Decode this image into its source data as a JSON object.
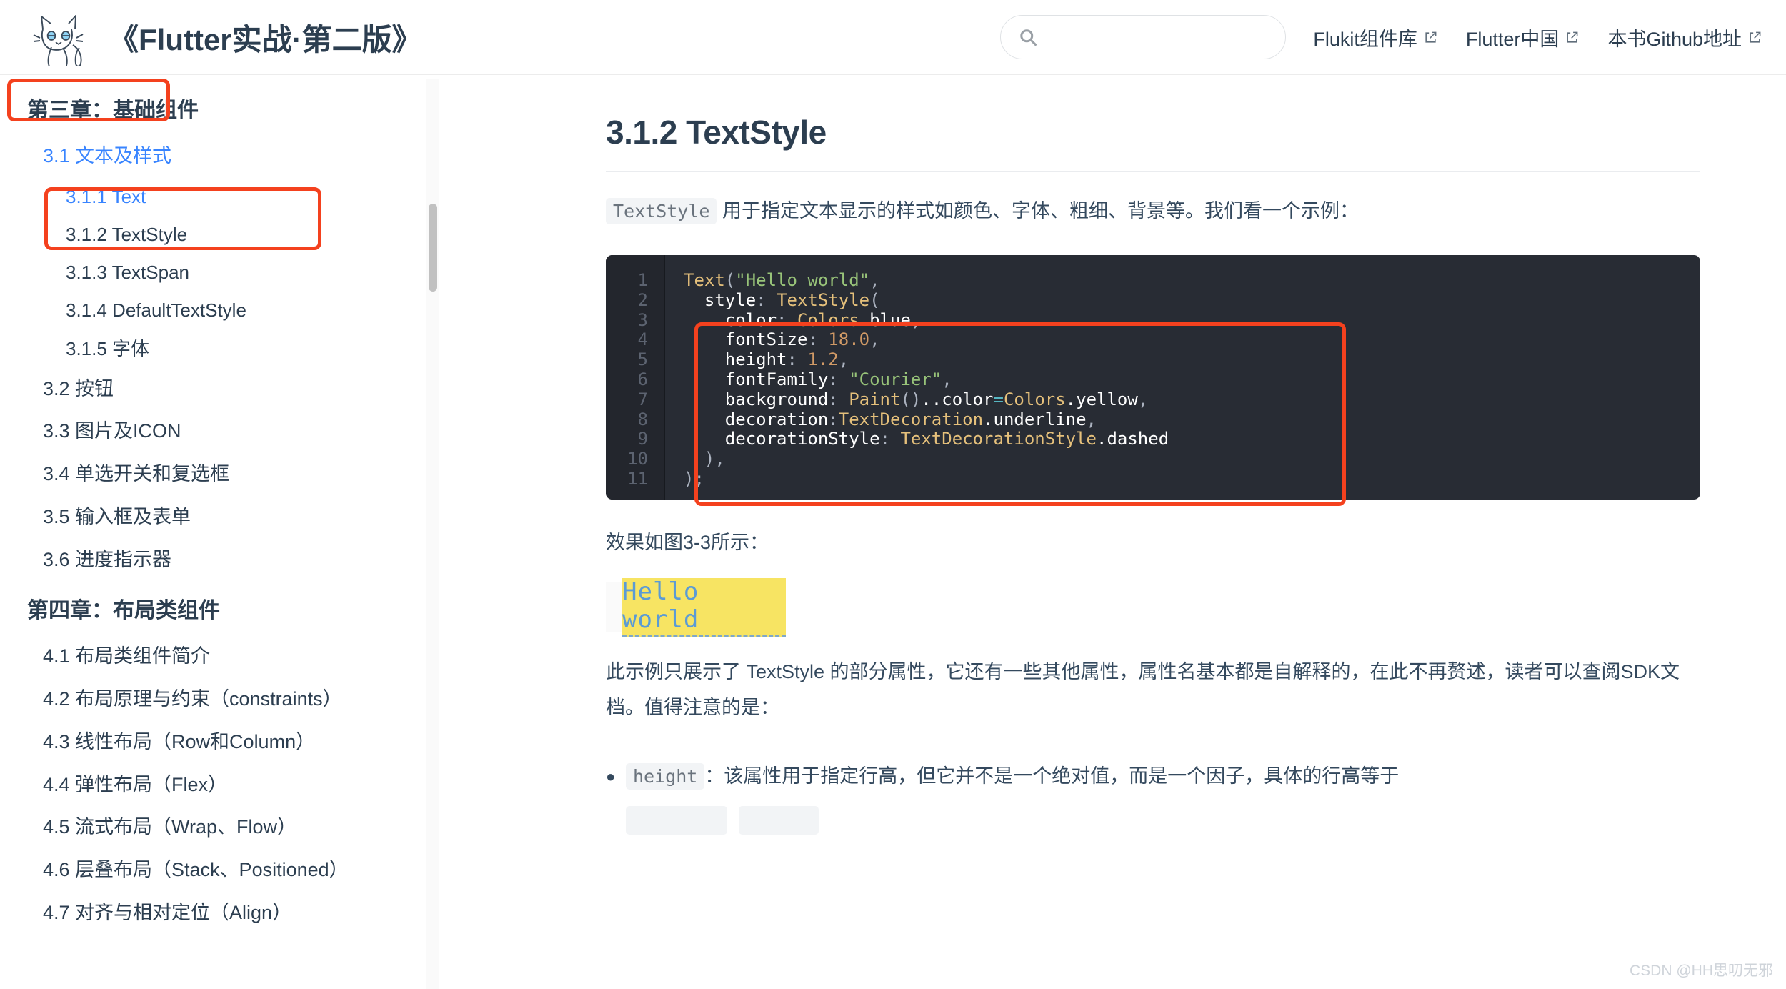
{
  "header": {
    "book_title": "《Flutter实战·第二版》",
    "logo_icon": "cat-logo-icon",
    "search": {
      "value": "",
      "placeholder": "",
      "icon": "search-icon"
    },
    "nav_links": [
      {
        "label": "Flukit组件库",
        "icon": "external-link-icon"
      },
      {
        "label": "Flutter中国",
        "icon": "external-link-icon"
      },
      {
        "label": "本书Github地址",
        "icon": "external-link-icon"
      }
    ]
  },
  "sidebar": {
    "items": [
      {
        "type": "chapter",
        "label": "第三章：基础组件",
        "active": false
      },
      {
        "type": "section",
        "label": "3.1 文本及样式",
        "active": true
      },
      {
        "type": "subsection",
        "label": "3.1.1 Text",
        "active": true
      },
      {
        "type": "subsection",
        "label": "3.1.2 TextStyle",
        "active": false
      },
      {
        "type": "subsection",
        "label": "3.1.3 TextSpan",
        "active": false
      },
      {
        "type": "subsection",
        "label": "3.1.4 DefaultTextStyle",
        "active": false
      },
      {
        "type": "subsection",
        "label": "3.1.5 字体",
        "active": false
      },
      {
        "type": "section",
        "label": "3.2 按钮",
        "active": false
      },
      {
        "type": "section",
        "label": "3.3 图片及ICON",
        "active": false
      },
      {
        "type": "section",
        "label": "3.4 单选开关和复选框",
        "active": false
      },
      {
        "type": "section",
        "label": "3.5 输入框及表单",
        "active": false
      },
      {
        "type": "section",
        "label": "3.6 进度指示器",
        "active": false
      },
      {
        "type": "chapter",
        "label": "第四章：布局类组件",
        "active": false
      },
      {
        "type": "section",
        "label": "4.1 布局类组件简介",
        "active": false
      },
      {
        "type": "section",
        "label": "4.2 布局原理与约束（constraints）",
        "active": false
      },
      {
        "type": "section",
        "label": "4.3 线性布局（Row和Column）",
        "active": false
      },
      {
        "type": "section",
        "label": "4.4 弹性布局（Flex）",
        "active": false
      },
      {
        "type": "section",
        "label": "4.5 流式布局（Wrap、Flow）",
        "active": false
      },
      {
        "type": "section",
        "label": "4.6 层叠布局（Stack、Positioned）",
        "active": false
      },
      {
        "type": "section",
        "label": "4.7 对齐与相对定位（Align）",
        "active": false
      }
    ]
  },
  "main": {
    "title": "3.1.2 TextStyle",
    "intro_code": "TextStyle",
    "intro_text": " 用于指定文本显示的样式如颜色、字体、粗细、背景等。我们看一个示例：",
    "code_lines": [
      {
        "n": "1",
        "tokens": [
          {
            "t": "cls",
            "v": "Text"
          },
          {
            "t": "pun",
            "v": "("
          },
          {
            "t": "str",
            "v": "\"Hello world\""
          },
          {
            "t": "pun",
            "v": ","
          }
        ]
      },
      {
        "n": "2",
        "tokens": [
          {
            "t": "id",
            "v": "  style"
          },
          {
            "t": "pun",
            "v": ": "
          },
          {
            "t": "cls",
            "v": "TextStyle"
          },
          {
            "t": "pun",
            "v": "("
          }
        ]
      },
      {
        "n": "3",
        "tokens": [
          {
            "t": "id",
            "v": "    color"
          },
          {
            "t": "pun",
            "v": ": "
          },
          {
            "t": "cls",
            "v": "Colors"
          },
          {
            "t": "id",
            "v": ".blue"
          },
          {
            "t": "pun",
            "v": ","
          }
        ]
      },
      {
        "n": "4",
        "tokens": [
          {
            "t": "id",
            "v": "    fontSize"
          },
          {
            "t": "pun",
            "v": ": "
          },
          {
            "t": "num",
            "v": "18.0"
          },
          {
            "t": "pun",
            "v": ","
          }
        ]
      },
      {
        "n": "5",
        "tokens": [
          {
            "t": "id",
            "v": "    height"
          },
          {
            "t": "pun",
            "v": ": "
          },
          {
            "t": "num",
            "v": "1.2"
          },
          {
            "t": "pun",
            "v": ","
          }
        ]
      },
      {
        "n": "6",
        "tokens": [
          {
            "t": "id",
            "v": "    fontFamily"
          },
          {
            "t": "pun",
            "v": ": "
          },
          {
            "t": "str",
            "v": "\"Courier\""
          },
          {
            "t": "pun",
            "v": ","
          }
        ]
      },
      {
        "n": "7",
        "tokens": [
          {
            "t": "id",
            "v": "    background"
          },
          {
            "t": "pun",
            "v": ": "
          },
          {
            "t": "cls",
            "v": "Paint"
          },
          {
            "t": "pun",
            "v": "()"
          },
          {
            "t": "id",
            "v": "..color"
          },
          {
            "t": "op",
            "v": "="
          },
          {
            "t": "cls",
            "v": "Colors"
          },
          {
            "t": "id",
            "v": ".yellow"
          },
          {
            "t": "pun",
            "v": ","
          }
        ]
      },
      {
        "n": "8",
        "tokens": [
          {
            "t": "id",
            "v": "    decoration"
          },
          {
            "t": "pun",
            "v": ":"
          },
          {
            "t": "cls",
            "v": "TextDecoration"
          },
          {
            "t": "id",
            "v": ".underline"
          },
          {
            "t": "pun",
            "v": ","
          }
        ]
      },
      {
        "n": "9",
        "tokens": [
          {
            "t": "id",
            "v": "    decorationStyle"
          },
          {
            "t": "pun",
            "v": ": "
          },
          {
            "t": "cls",
            "v": "TextDecorationStyle"
          },
          {
            "t": "id",
            "v": ".dashed"
          }
        ]
      },
      {
        "n": "10",
        "tokens": [
          {
            "t": "pun",
            "v": "  ),"
          }
        ]
      },
      {
        "n": "11",
        "tokens": [
          {
            "t": "pun",
            "v": ");"
          }
        ]
      }
    ],
    "figure_caption": "效果如图3-3所示：",
    "demo_text": "Hello world",
    "body_text": "此示例只展示了 TextStyle 的部分属性，它还有一些其他属性，属性名基本都是自解释的，在此不再赘述，读者可以查阅SDK文档。值得注意的是：",
    "bullet_code": "height",
    "bullet_text": "：该属性用于指定行高，但它并不是一个绝对值，而是一个因子，具体的行高等于"
  },
  "watermark": "CSDN @HH思叨无邪",
  "colors": {
    "accent_blue": "#3884ff",
    "annotation_red": "#f4411e",
    "code_bg": "#282c34",
    "text_dark": "#2c3e50",
    "demo_highlight": "#f7e463",
    "demo_text": "#5b9bd5"
  }
}
